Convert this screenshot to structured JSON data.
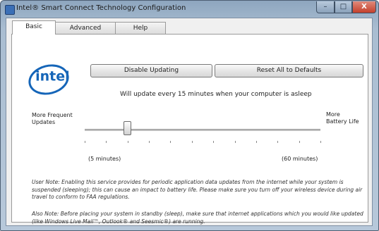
{
  "window": {
    "title": "Intel® Smart Connect Technology Configuration"
  },
  "controls": {
    "minimize": "–",
    "maximize": "□",
    "close": "X"
  },
  "tabs": [
    {
      "label": "Basic",
      "selected": true
    },
    {
      "label": "Advanced",
      "selected": false
    },
    {
      "label": "Help",
      "selected": false
    }
  ],
  "logo": {
    "text": "intel",
    "color": "#1565b8"
  },
  "buttons": {
    "disable": "Disable Updating",
    "reset": "Reset All to Defaults"
  },
  "update_info": "Will update every 15 minutes when your computer is asleep",
  "slider": {
    "left_label": "More Frequent Updates",
    "right_label": "More Battery Life",
    "min_label": "(5 minutes)",
    "max_label": "(60 minutes)",
    "value_fraction": 0.18,
    "tick_count": 12
  },
  "notes": {
    "user_note": "User Note: Enabling this service provides for periodic application data updates from the internet while your system is suspended (sleeping); this can cause an impact to battery life. Please make sure you turn off your wireless device during air travel to conform to FAA regulations.",
    "also_note": "Also Note: Before placing your system in standby (sleep), make sure that internet applications which you would like updated (like Windows Live Mail™, Outlook® and Seesmic®) are running."
  }
}
